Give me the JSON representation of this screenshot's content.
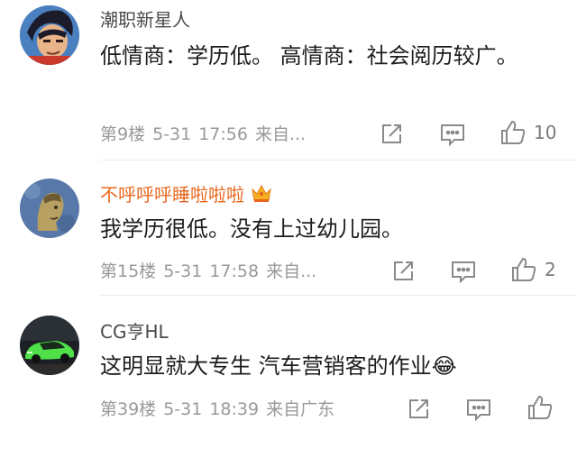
{
  "comments": [
    {
      "username": "潮职新星人",
      "content": "低情商：学历低。 高情商：社会阅历较广。",
      "floor": "第9楼",
      "date": "5-31",
      "time": "17:56",
      "source": "来自...",
      "likes": "10"
    },
    {
      "username": "不呼呼呼睡啦啦啦",
      "content": "我学历很低。没有上过幼儿园。",
      "floor": "第15楼",
      "date": "5-31",
      "time": "17:58",
      "source": "来自...",
      "likes": "2"
    },
    {
      "username": "CG亨HL",
      "content": "这明显就大专生 汽车营销客的作业😂",
      "floor": "第39楼",
      "date": "5-31",
      "time": "18:39",
      "source": "来自广东",
      "likes": ""
    }
  ],
  "icons": {
    "share": "share-icon",
    "comment": "comment-icon",
    "like": "like-icon",
    "vip": "vip-crown-icon"
  },
  "colors": {
    "vip_name": "#e8661c",
    "meta": "#999999"
  }
}
